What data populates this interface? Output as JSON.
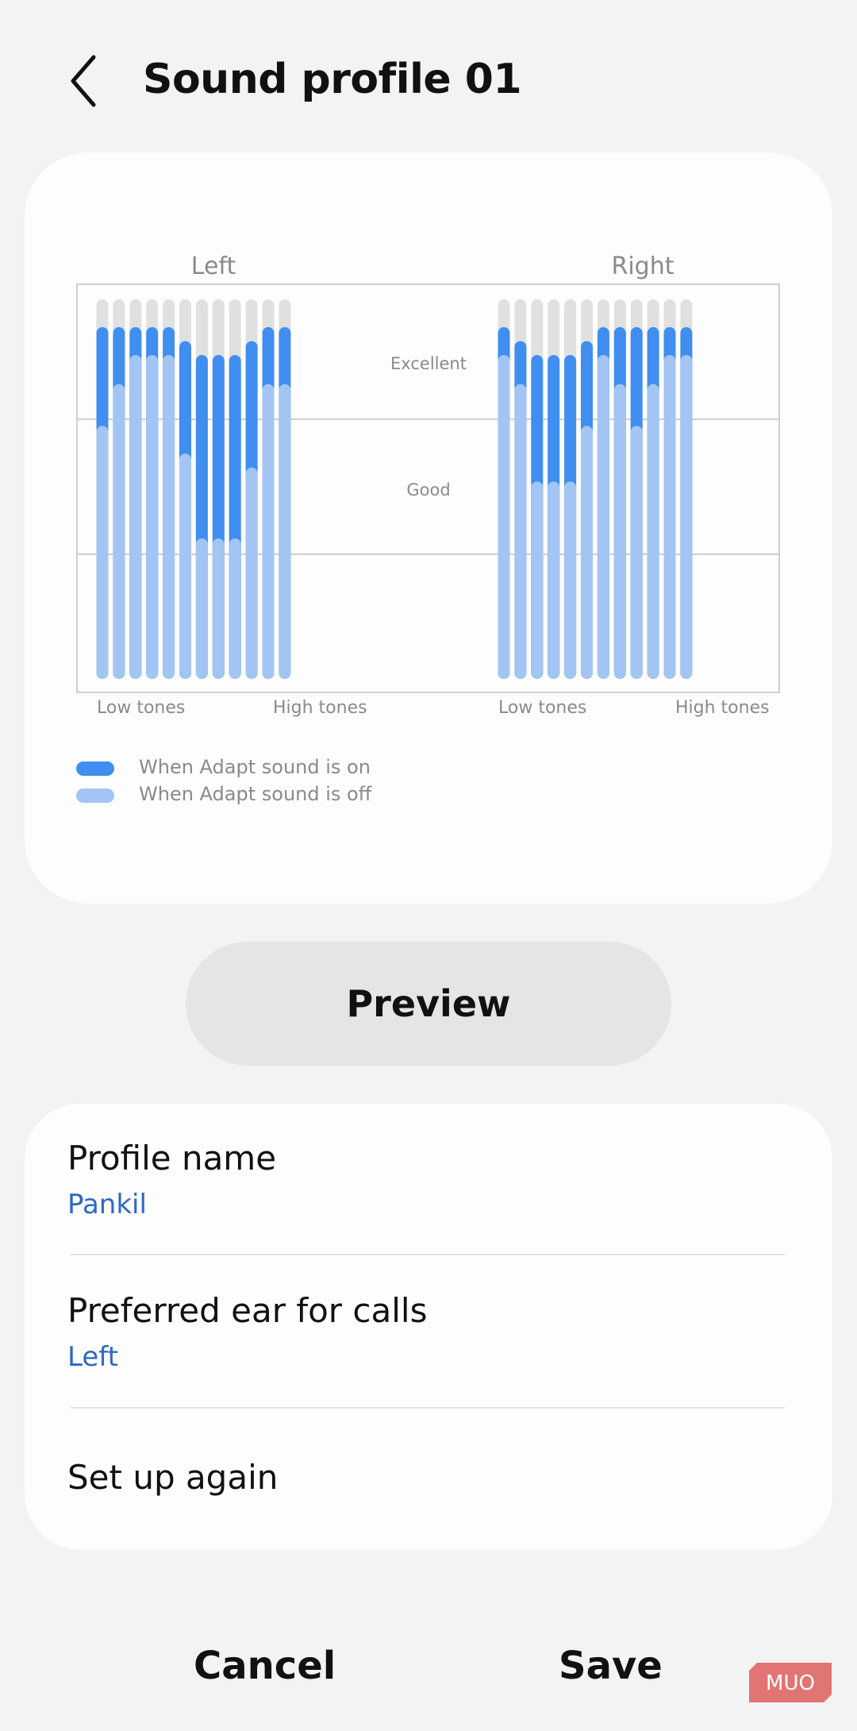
{
  "header": {
    "title": "Sound profile 01"
  },
  "chart_data": {
    "type": "bar",
    "levels": [
      "Excellent",
      "Good"
    ],
    "xlabels": [
      "Low tones",
      "High tones"
    ],
    "legend": [
      "When Adapt sound is on",
      "When Adapt sound is off"
    ],
    "colors": {
      "on": "#3f8ef0",
      "off": "#a3c5f3",
      "track": "#e0e0e0",
      "grid": "#cfcfcf",
      "label": "#8a8a8a"
    },
    "ylim": [
      0,
      3
    ],
    "panels": [
      {
        "title": "Left",
        "adapt_on": [
          2.78,
          2.78,
          2.78,
          2.78,
          2.78,
          2.67,
          2.56,
          2.56,
          2.56,
          2.67,
          2.78,
          2.78
        ],
        "adapt_off": [
          2.0,
          2.33,
          2.56,
          2.56,
          2.56,
          1.78,
          1.11,
          1.11,
          1.11,
          1.67,
          2.33,
          2.33
        ]
      },
      {
        "title": "Right",
        "adapt_on": [
          2.78,
          2.67,
          2.56,
          2.56,
          2.56,
          2.67,
          2.78,
          2.78,
          2.78,
          2.78,
          2.78,
          2.78
        ],
        "adapt_off": [
          2.56,
          2.33,
          1.56,
          1.56,
          1.56,
          2.0,
          2.56,
          2.33,
          2.0,
          2.33,
          2.56,
          2.56
        ]
      }
    ]
  },
  "actions": {
    "preview": "Preview",
    "cancel": "Cancel",
    "save": "Save"
  },
  "settings": {
    "profile_name": {
      "title": "Profile name",
      "value": "Pankil"
    },
    "preferred_ear": {
      "title": "Preferred ear for calls",
      "value": "Left"
    },
    "setup_again": {
      "title": "Set up again"
    }
  },
  "watermark": {
    "text": "MUO",
    "color": "#e06666"
  }
}
